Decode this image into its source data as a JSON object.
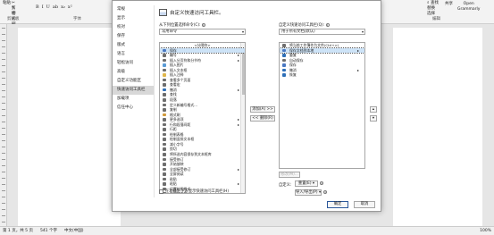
{
  "ribbon": {
    "paste_label": "粘贴",
    "cut_label": "✂ 剪切",
    "format_painter_label": "✎ 格式刷",
    "clipboard_group": "剪贴板",
    "font_group": "字体",
    "fmt_buttons": [
      "B",
      "I",
      "U",
      "ab",
      "x₂",
      "x²"
    ],
    "find_label": "⌕ 查找",
    "replace_label": "替换",
    "select_label": "选择",
    "share_label": "共享",
    "open_grammarly_line1": "Open",
    "open_grammarly_line2": "Grammarly",
    "edit_label": "编辑"
  },
  "status": {
    "page": "第 1 页，共 5 页",
    "words": "541 个字",
    "lang": "中文(中国)",
    "zoom": "100%"
  },
  "dialog": {
    "nav": [
      {
        "label": "常规",
        "active": false
      },
      {
        "label": "显示",
        "active": false
      },
      {
        "label": "校对",
        "active": false
      },
      {
        "label": "保存",
        "active": false
      },
      {
        "label": "版式",
        "active": false
      },
      {
        "label": "语言",
        "active": false
      },
      {
        "label": "轻松访问",
        "active": false
      },
      {
        "label": "高级",
        "active": false
      },
      {
        "label": "自定义功能区",
        "active": false
      },
      {
        "label": "快速访问工具栏",
        "active": true
      },
      {
        "label": "加载项",
        "active": false
      },
      {
        "label": "信任中心",
        "active": false
      }
    ],
    "heading": "自定义快速访问工具栏。",
    "choose_label": "从下列位置选择命令(C):",
    "choose_value": "常用命令",
    "customize_label": "自定义快速访问工具栏(Q):",
    "customize_value": "用于所有文档(默认)",
    "left_list": [
      {
        "label": "<分隔符>",
        "center": true,
        "color": "",
        "sub": false
      },
      {
        "label": "保存",
        "color": "#4a78c2",
        "sub": false,
        "selected": true
      },
      {
        "label": "编号",
        "color": "#6d6d6d",
        "sub": true
      },
      {
        "label": "插入分页符和分节符",
        "color": "#6d6d6d",
        "sub": true
      },
      {
        "label": "插入图片",
        "color": "#5a9bd5",
        "sub": false
      },
      {
        "label": "插入文本框",
        "color": "#6d6d6d",
        "sub": false
      },
      {
        "label": "插入注释",
        "color": "#e0b64a",
        "sub": false
      },
      {
        "label": "查看多个页面",
        "color": "#6d6d6d",
        "sub": false
      },
      {
        "label": "查看宏",
        "color": "#6d6d6d",
        "sub": false
      },
      {
        "label": "撤消",
        "color": "#2e6fb8",
        "sub": true
      },
      {
        "label": "查找",
        "color": "#6d6d6d",
        "sub": false
      },
      {
        "label": "段落",
        "color": "#6d6d6d",
        "sub": false
      },
      {
        "label": "定义新编号格式...",
        "color": "#6d6d6d",
        "sub": false
      },
      {
        "label": "复制",
        "color": "#6d6d6d",
        "sub": false
      },
      {
        "label": "格式刷",
        "color": "#d19a3b",
        "sub": false
      },
      {
        "label": "更多选项",
        "color": "#6d6d6d",
        "sub": true
      },
      {
        "label": "行和段落间距",
        "color": "#6d6d6d",
        "sub": true
      },
      {
        "label": "行距",
        "color": "#6d6d6d",
        "sub": false
      },
      {
        "label": "绘制表格",
        "color": "#6d6d6d",
        "sub": false
      },
      {
        "label": "绘制竖排文本框",
        "color": "#6d6d6d",
        "sub": false
      },
      {
        "label": "减小字号",
        "color": "#6d6d6d",
        "sub": false
      },
      {
        "label": "剪切",
        "color": "#6d6d6d",
        "sub": false
      },
      {
        "label": "将所选内容保存到文本框库",
        "color": "#6d6d6d",
        "sub": false
      },
      {
        "label": "接受修订",
        "color": "#6d6d6d",
        "sub": false
      },
      {
        "label": "开始放映",
        "color": "#6d6d6d",
        "sub": false
      },
      {
        "label": "全部接受修订",
        "color": "#6d6d6d",
        "sub": true
      },
      {
        "label": "全屏阅读",
        "color": "#6d6d6d",
        "sub": false
      },
      {
        "label": "粘贴",
        "color": "#6d6d6d",
        "sub": false
      },
      {
        "label": "粘贴",
        "color": "#6d6d6d",
        "sub": true
      },
      {
        "label": "设置绘图格式",
        "color": "#6d6d6d",
        "sub": false
      },
      {
        "label": "绘制文本框",
        "color": "#6d6d6d",
        "sub": true
      },
      {
        "label": "字号",
        "color": "#6d6d6d",
        "sub": false
      },
      {
        "label": "增大字号",
        "color": "#6d6d6d",
        "sub": false
      }
    ],
    "right_list": [
      {
        "label": "将当前工作簿作为文件(Ctrl+>)",
        "color": "#6d6d6d",
        "sub": false
      },
      {
        "label": "保存文档到本地",
        "color": "#4a78c2",
        "sub": true,
        "selected": true
      },
      {
        "label": "重复",
        "color": "#2e6fb8",
        "sub": false
      },
      {
        "label": "自动保存",
        "color": "#6d6d6d",
        "sub": false
      },
      {
        "label": "保存",
        "color": "#4a78c2",
        "sub": false
      },
      {
        "label": "撤消",
        "color": "#2e6fb8",
        "sub": true
      },
      {
        "label": "恢复",
        "color": "#2e6fb8",
        "sub": false
      }
    ],
    "add_button": "添加(A) >>",
    "remove_button": "<< 删除(R)",
    "modify_button": "修改(M)...",
    "custom_label": "自定义:",
    "reset_button": "重置(E) ▾",
    "import_button": "导入/导出(P) ▾",
    "show_below_label": "在功能区下方显示快速访问工具栏(H)",
    "ok_button": "确定",
    "cancel_button": "取消"
  }
}
